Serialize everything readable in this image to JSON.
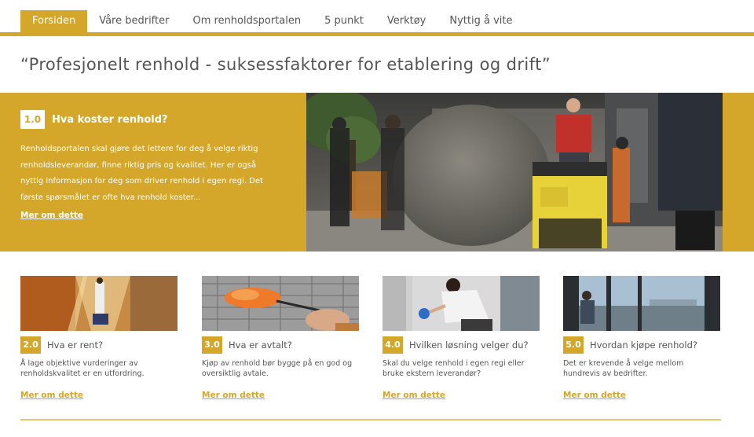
{
  "nav": {
    "items": [
      {
        "label": "Forsiden",
        "active": true
      },
      {
        "label": "Våre bedrifter",
        "active": false
      },
      {
        "label": "Om renholdsportalen",
        "active": false
      },
      {
        "label": "5 punkt",
        "active": false
      },
      {
        "label": "Verktøy",
        "active": false
      },
      {
        "label": "Nyttig å vite",
        "active": false
      }
    ]
  },
  "quote": "“Profesjonelt renhold - suksessfaktorer for etablering og drift”",
  "hero": {
    "number": "1.0",
    "title": "Hva koster renhold?",
    "body": "Renholdsportalen skal gjøre det lettere for deg å velge riktig renholdsleverandør, finne riktig pris og kvalitet. Her er også nyttig informasjon for deg som driver renhold i egen regi. Det første spørsmålet er ofte hva renhold koster...",
    "link": "Mer om dette"
  },
  "cards": [
    {
      "number": "2.0",
      "title": "Hva er rent?",
      "body": "Å lage objektive vurderinger av renholdskvalitet er en utfordring.",
      "link": "Mer om dette"
    },
    {
      "number": "3.0",
      "title": "Hva er avtalt?",
      "body": "Kjøp av renhold bør bygge på en god og oversiktlig avtale.",
      "link": "Mer om dette"
    },
    {
      "number": "4.0",
      "title": "Hvilken løsning velger du?",
      "body": "Skal du velge renhold i egen regi eller bruke ekstern leverandør?",
      "link": "Mer om dette"
    },
    {
      "number": "5.0",
      "title": "Hvordan kjøpe renhold?",
      "body": "Det er krevende å velge mellom hundrevis av bedrifter.",
      "link": "Mer om dette"
    }
  ],
  "colors": {
    "accent": "#d4a62a",
    "text": "#555555",
    "background": "#ffffff"
  }
}
